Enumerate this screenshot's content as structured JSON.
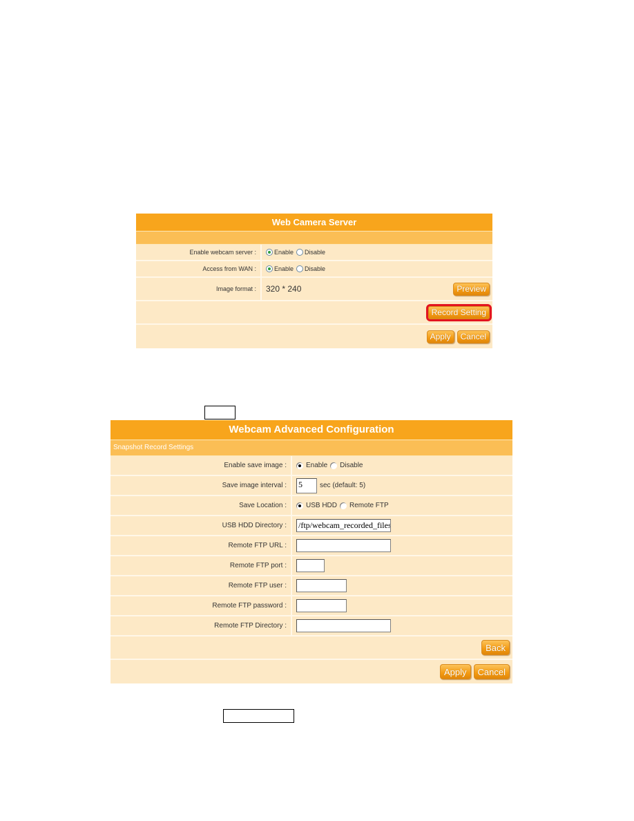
{
  "web_camera_server": {
    "title": "Web Camera Server",
    "rows": [
      {
        "label": "Enable webcam server :",
        "options": [
          "Enable",
          "Disable"
        ],
        "selected": "Enable"
      },
      {
        "label": "Access from WAN :",
        "options": [
          "Enable",
          "Disable"
        ],
        "selected": "Enable"
      },
      {
        "label": "Image format :",
        "value": "320 * 240"
      }
    ],
    "buttons": {
      "preview": "Preview",
      "record_setting": "Record Setting",
      "apply": "Apply",
      "cancel": "Cancel"
    },
    "highlight_color": "#e3141f"
  },
  "webcam_advanced": {
    "title": "Webcam Advanced Configuration",
    "section": "Snapshot Record Settings",
    "enable_save_image": {
      "label": "Enable save image :",
      "options": [
        "Enable",
        "Disable"
      ],
      "selected": "Enable"
    },
    "save_interval": {
      "label": "Save image interval :",
      "value": "5",
      "hint": "sec (default: 5)"
    },
    "save_location": {
      "label": "Save Location :",
      "options": [
        "USB HDD",
        "Remote FTP"
      ],
      "selected": "USB HDD"
    },
    "usb_hdd_directory": {
      "label": "USB HDD Directory :",
      "value": "/ftp/webcam_recorded_files/"
    },
    "remote_ftp_url": {
      "label": "Remote FTP URL :",
      "value": ""
    },
    "remote_ftp_port": {
      "label": "Remote FTP port :",
      "value": ""
    },
    "remote_ftp_user": {
      "label": "Remote FTP user :",
      "value": ""
    },
    "remote_ftp_password": {
      "label": "Remote FTP password :",
      "value": ""
    },
    "remote_ftp_directory": {
      "label": "Remote FTP Directory :",
      "value": ""
    },
    "buttons": {
      "back": "Back",
      "apply": "Apply",
      "cancel": "Cancel"
    }
  },
  "theme": {
    "header": "#f8a51c",
    "subheader": "#fbbe55",
    "row": "#fde9c6"
  }
}
